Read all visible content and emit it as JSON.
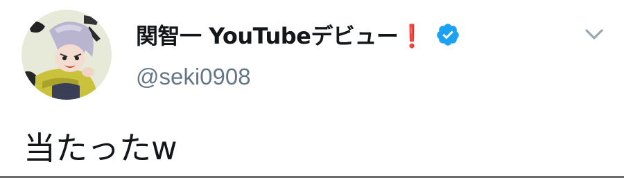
{
  "tweet": {
    "author": {
      "display_name": "関智一 YouTubeデビュー❗",
      "handle": "@seki0908",
      "verified": true,
      "avatar_icon": "avatar-illustration"
    },
    "text": "当たったw",
    "menu_icon": "chevron-down-icon"
  },
  "colors": {
    "verified_blue": "#1da1f2",
    "handle_gray": "#657786",
    "text_dark": "#14171a",
    "chevron_gray": "#9aa6b2"
  }
}
